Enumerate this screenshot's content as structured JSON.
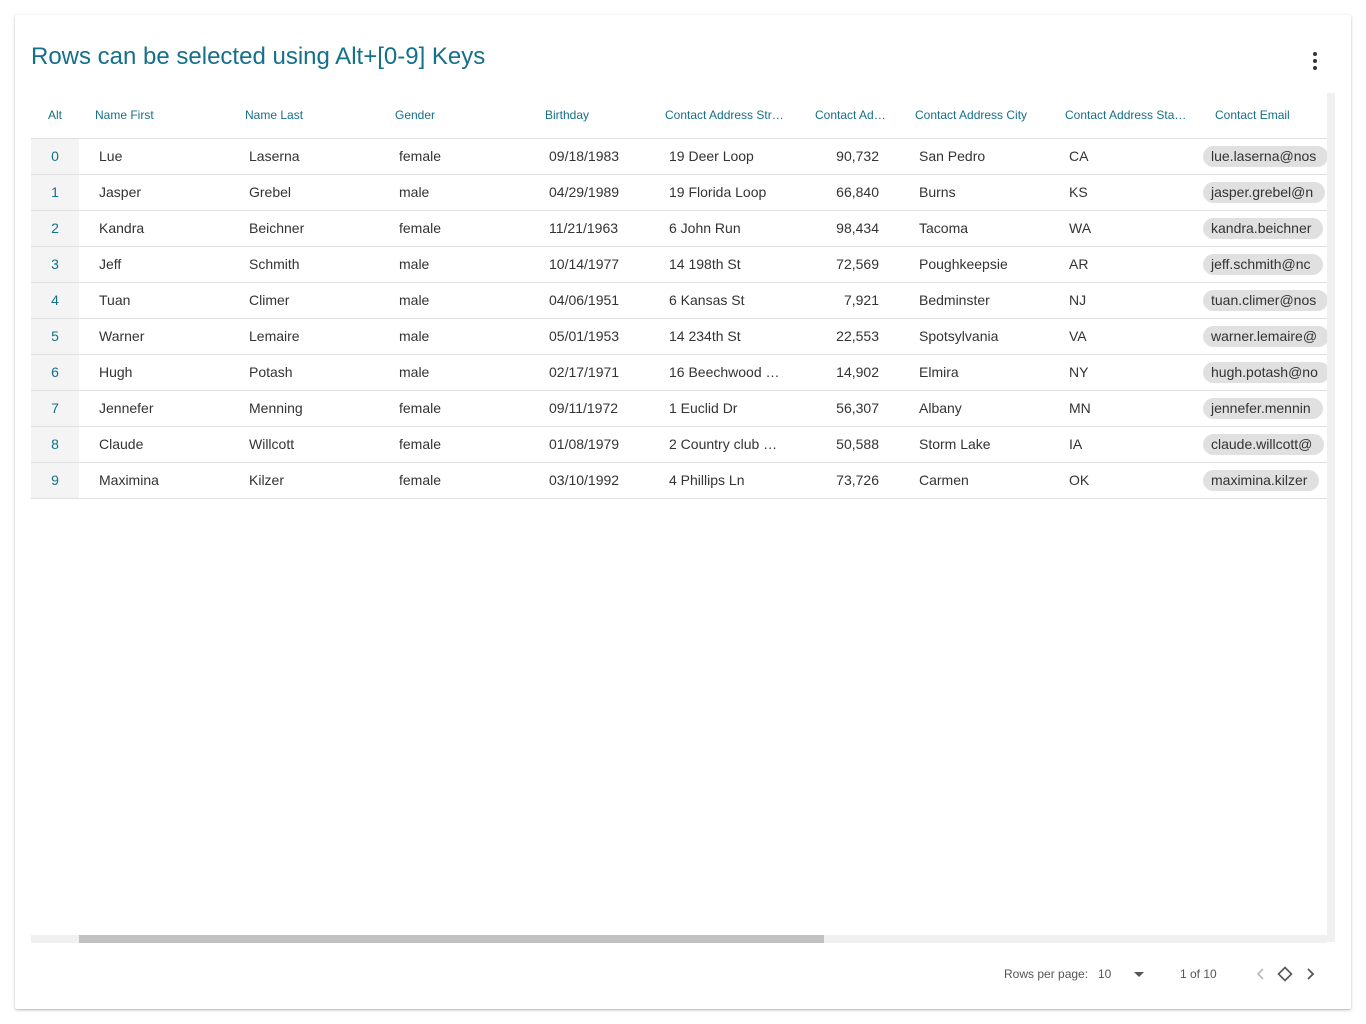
{
  "title": "Rows can be selected using Alt+[0-9] Keys",
  "menu_icon": "more-vert-icon",
  "columns": [
    "Alt",
    "Name First",
    "Name Last",
    "Gender",
    "Birthday",
    "Contact Address Str…",
    "Contact Ad…",
    "Contact Address City",
    "Contact Address Sta…",
    "Contact Email"
  ],
  "rows": [
    {
      "alt": "0",
      "first": "Lue",
      "last": "Laserna",
      "gender": "female",
      "birthday": "09/18/1983",
      "street": "19 Deer Loop",
      "zip": "90,732",
      "city": "San Pedro",
      "state": "CA",
      "email": "lue.laserna@nos"
    },
    {
      "alt": "1",
      "first": "Jasper",
      "last": "Grebel",
      "gender": "male",
      "birthday": "04/29/1989",
      "street": "19 Florida Loop",
      "zip": "66,840",
      "city": "Burns",
      "state": "KS",
      "email": "jasper.grebel@n"
    },
    {
      "alt": "2",
      "first": "Kandra",
      "last": "Beichner",
      "gender": "female",
      "birthday": "11/21/1963",
      "street": "6 John Run",
      "zip": "98,434",
      "city": "Tacoma",
      "state": "WA",
      "email": "kandra.beichner"
    },
    {
      "alt": "3",
      "first": "Jeff",
      "last": "Schmith",
      "gender": "male",
      "birthday": "10/14/1977",
      "street": "14 198th St",
      "zip": "72,569",
      "city": "Poughkeepsie",
      "state": "AR",
      "email": "jeff.schmith@nc"
    },
    {
      "alt": "4",
      "first": "Tuan",
      "last": "Climer",
      "gender": "male",
      "birthday": "04/06/1951",
      "street": "6 Kansas St",
      "zip": "7,921",
      "city": "Bedminster",
      "state": "NJ",
      "email": "tuan.climer@nos"
    },
    {
      "alt": "5",
      "first": "Warner",
      "last": "Lemaire",
      "gender": "male",
      "birthday": "05/01/1953",
      "street": "14 234th St",
      "zip": "22,553",
      "city": "Spotsylvania",
      "state": "VA",
      "email": "warner.lemaire@"
    },
    {
      "alt": "6",
      "first": "Hugh",
      "last": "Potash",
      "gender": "male",
      "birthday": "02/17/1971",
      "street": "16 Beechwood …",
      "zip": "14,902",
      "city": "Elmira",
      "state": "NY",
      "email": "hugh.potash@no"
    },
    {
      "alt": "7",
      "first": "Jennefer",
      "last": "Menning",
      "gender": "female",
      "birthday": "09/11/1972",
      "street": "1 Euclid Dr",
      "zip": "56,307",
      "city": "Albany",
      "state": "MN",
      "email": "jennefer.mennin"
    },
    {
      "alt": "8",
      "first": "Claude",
      "last": "Willcott",
      "gender": "female",
      "birthday": "01/08/1979",
      "street": "2 Country club …",
      "zip": "50,588",
      "city": "Storm Lake",
      "state": "IA",
      "email": "claude.willcott@"
    },
    {
      "alt": "9",
      "first": "Maximina",
      "last": "Kilzer",
      "gender": "female",
      "birthday": "03/10/1992",
      "street": "4 Phillips Ln",
      "zip": "73,726",
      "city": "Carmen",
      "state": "OK",
      "email": "maximina.kilzer"
    }
  ],
  "footer": {
    "rows_per_page_label": "Rows per page:",
    "rows_per_page_value": "10",
    "range": "1 of 10"
  },
  "colors": {
    "accent": "#15708a",
    "alt_cell_bg": "#f4f4f4",
    "chip_bg": "#e0e0e0"
  }
}
